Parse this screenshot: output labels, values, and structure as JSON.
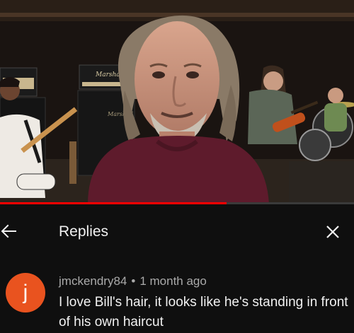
{
  "video": {
    "amp_brand": "Marshall",
    "progress_fraction": 0.64
  },
  "replies_panel": {
    "title": "Replies",
    "back_icon": "arrow-left-icon",
    "close_icon": "close-icon"
  },
  "comment": {
    "avatar_letter": "j",
    "avatar_color": "#e9531f",
    "author": "jmckendry84",
    "separator": "•",
    "timestamp": "1 month ago",
    "text": "I love Bill's hair, it looks like he's standing in front of his own haircut"
  },
  "colors": {
    "background": "#0f0f0f",
    "primary_text": "#f1f1f1",
    "secondary_text": "#aaaaaa",
    "progress": "#ff0000"
  }
}
